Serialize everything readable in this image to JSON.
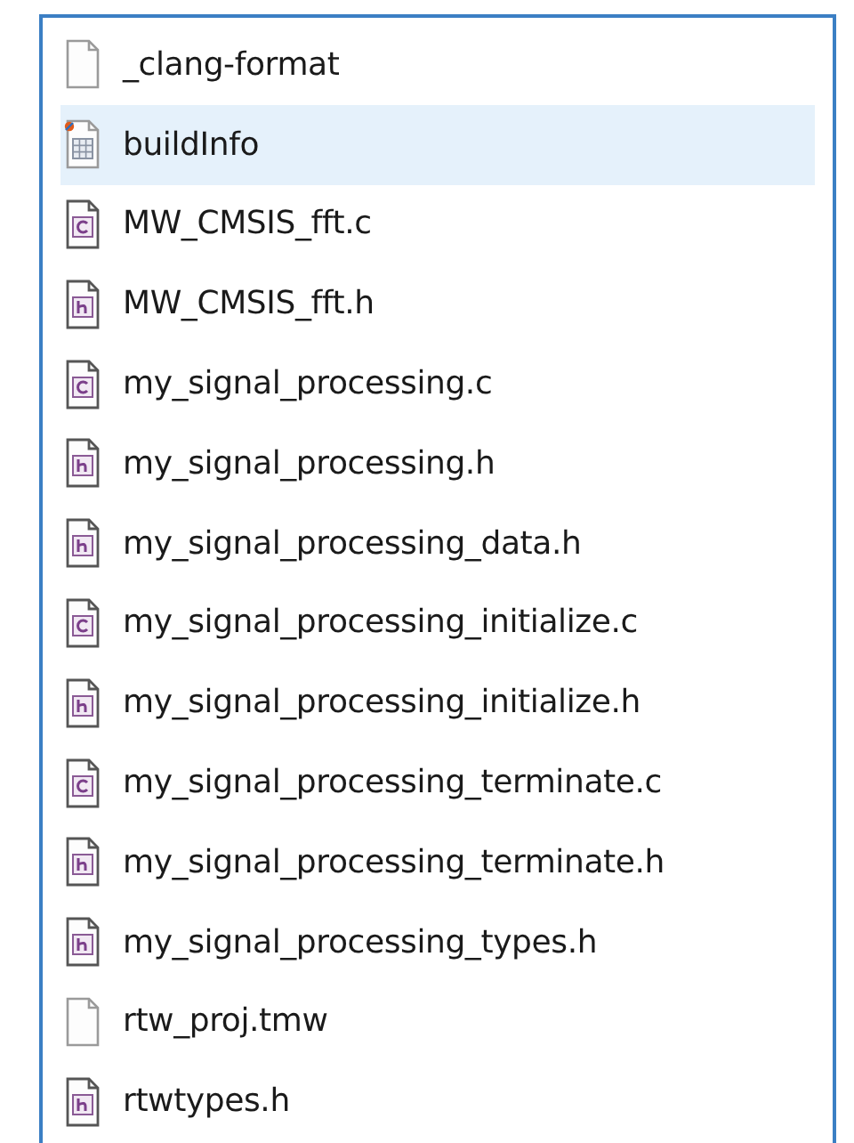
{
  "files": [
    {
      "name": "_clang-format",
      "kind": "blank",
      "selected": false
    },
    {
      "name": "buildInfo",
      "kind": "table",
      "selected": true
    },
    {
      "name": "MW_CMSIS_fft.c",
      "kind": "c",
      "selected": false
    },
    {
      "name": "MW_CMSIS_fft.h",
      "kind": "h",
      "selected": false
    },
    {
      "name": "my_signal_processing.c",
      "kind": "c",
      "selected": false
    },
    {
      "name": "my_signal_processing.h",
      "kind": "h",
      "selected": false
    },
    {
      "name": "my_signal_processing_data.h",
      "kind": "h",
      "selected": false
    },
    {
      "name": "my_signal_processing_initialize.c",
      "kind": "c",
      "selected": false
    },
    {
      "name": "my_signal_processing_initialize.h",
      "kind": "h",
      "selected": false
    },
    {
      "name": "my_signal_processing_terminate.c",
      "kind": "c",
      "selected": false
    },
    {
      "name": "my_signal_processing_terminate.h",
      "kind": "h",
      "selected": false
    },
    {
      "name": "my_signal_processing_types.h",
      "kind": "h",
      "selected": false
    },
    {
      "name": "rtw_proj.tmw",
      "kind": "blank",
      "selected": false
    },
    {
      "name": "rtwtypes.h",
      "kind": "h",
      "selected": false
    }
  ]
}
